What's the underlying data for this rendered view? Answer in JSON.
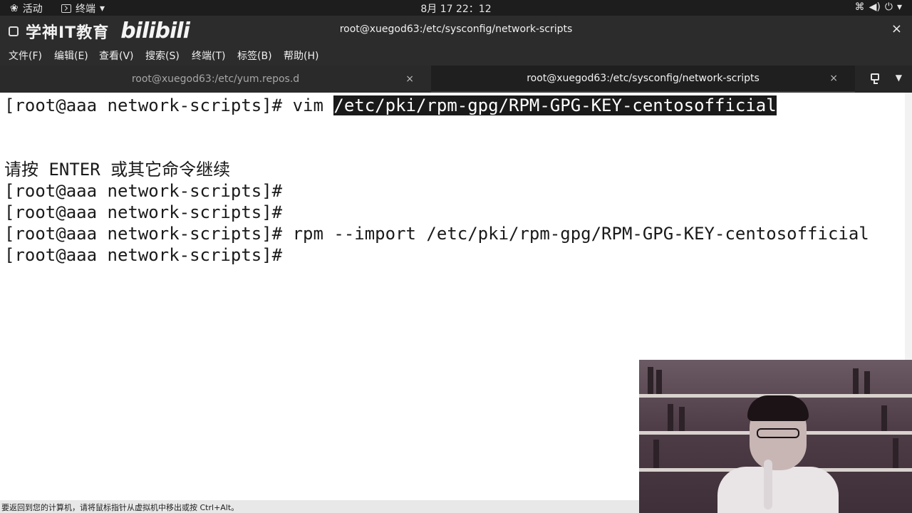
{
  "topbar": {
    "activities": "活动",
    "terminal_menu": "终端",
    "clock": "8月 17  22：12"
  },
  "window": {
    "brand_text": "学神IT教育",
    "brand_logo": "bilibili",
    "title": "root@xuegod63:/etc/sysconfig/network-scripts",
    "close": "×"
  },
  "menu": {
    "items": [
      "文件(F)",
      "编辑(E)",
      "查看(V)",
      "搜索(S)",
      "终端(T)",
      "标签(B)",
      "帮助(H)"
    ]
  },
  "tabs": [
    {
      "label": "root@xuegod63:/etc/yum.repos.d",
      "close": "×",
      "active": false
    },
    {
      "label": "root@xuegod63:/etc/sysconfig/network-scripts",
      "close": "×",
      "active": true
    }
  ],
  "terminal": {
    "line1_prompt": "[root@aaa network-scripts]# vim ",
    "line1_selected": "/etc/pki/rpm-gpg/RPM-GPG-KEY-centosofficial",
    "line2": "请按 ENTER 或其它命令继续",
    "line3": "[root@aaa network-scripts]#",
    "line4": "[root@aaa network-scripts]#",
    "line5": "[root@aaa network-scripts]# rpm --import /etc/pki/rpm-gpg/RPM-GPG-KEY-centosofficial",
    "line6": "[root@aaa network-scripts]#"
  },
  "status": {
    "text": "要返回到您的计算机，请将鼠标指针从虚拟机中移出或按 Ctrl+Alt。"
  },
  "icons": [
    "gnome-foot-icon",
    "terminal-icon",
    "network-icon",
    "volume-icon",
    "power-icon",
    "new-tab-icon",
    "dropdown-icon"
  ]
}
